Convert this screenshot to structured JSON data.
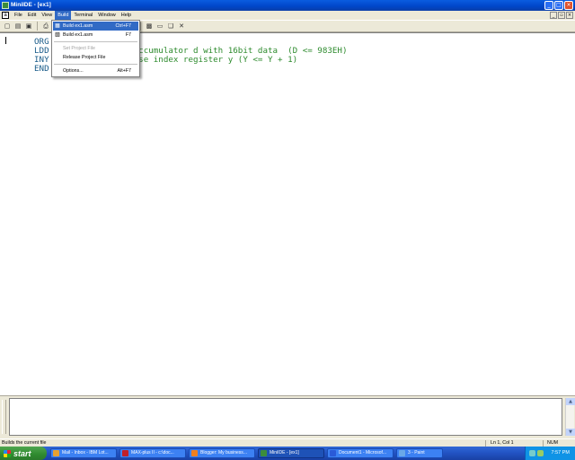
{
  "window": {
    "title": "MiniIDE - [ex1]"
  },
  "menu": {
    "items": [
      "File",
      "Edit",
      "View",
      "Build",
      "Terminal",
      "Window",
      "Help"
    ],
    "active_index": 3
  },
  "toolbar": {
    "icons": [
      "new-icon",
      "open-icon",
      "save-icon",
      "print-icon",
      "cut-icon",
      "copy-icon",
      "paste-icon",
      "undo-icon",
      "redo-icon",
      "build-icon",
      "build-all-icon",
      "stop-icon",
      "terminal-icon",
      "window-icon",
      "cascade-icon",
      "close-icon"
    ]
  },
  "build_menu": {
    "items": [
      {
        "label": "Build ex1.asm",
        "shortcut": "Ctrl+F7",
        "state": "selected"
      },
      {
        "label": "Build ex1.asm",
        "shortcut": "F7",
        "state": "normal"
      },
      {
        "label": "Set Project File",
        "shortcut": "",
        "state": "disabled"
      },
      {
        "label": "Release Project File",
        "shortcut": "",
        "state": "normal"
      },
      {
        "label": "Options...",
        "shortcut": "Alt+F7",
        "state": "normal"
      }
    ]
  },
  "editor": {
    "lines": [
      {
        "kw": "ORG",
        "rest": ""
      },
      {
        "kw": "LDD",
        "rest": "          ; load accumulator d with 16bit data  (D <= 983EH)"
      },
      {
        "kw": "INY",
        "rest": "          ; increase index register y (Y <= Y + 1)"
      },
      {
        "kw": "END",
        "rest": ""
      }
    ]
  },
  "statusbar": {
    "message": "Builds the current file",
    "position": "Ln 1, Col 1",
    "mode": "NUM"
  },
  "taskbar": {
    "start_label": "start",
    "tasks": [
      {
        "label": "Mail - Inbox - IBM Lot...",
        "color": "#e8a030"
      },
      {
        "label": "MAX-plus II - c:\\doc...",
        "color": "#c0202a"
      },
      {
        "label": "Blogger: My business...",
        "color": "#f08020"
      },
      {
        "label": "MiniIDE - [ex1]",
        "color": "#3c8c3c"
      },
      {
        "label": "Document1 - Microsof...",
        "color": "#2a5ad8"
      },
      {
        "label": "3 - Paint",
        "color": "#6aa8e8"
      }
    ],
    "active_task": 3,
    "clock": "7:57 PM"
  },
  "colors": {
    "menu_highlight": "#316ac5",
    "code_text": "#2e8b2e",
    "title_bar": "#0a5ce0"
  }
}
